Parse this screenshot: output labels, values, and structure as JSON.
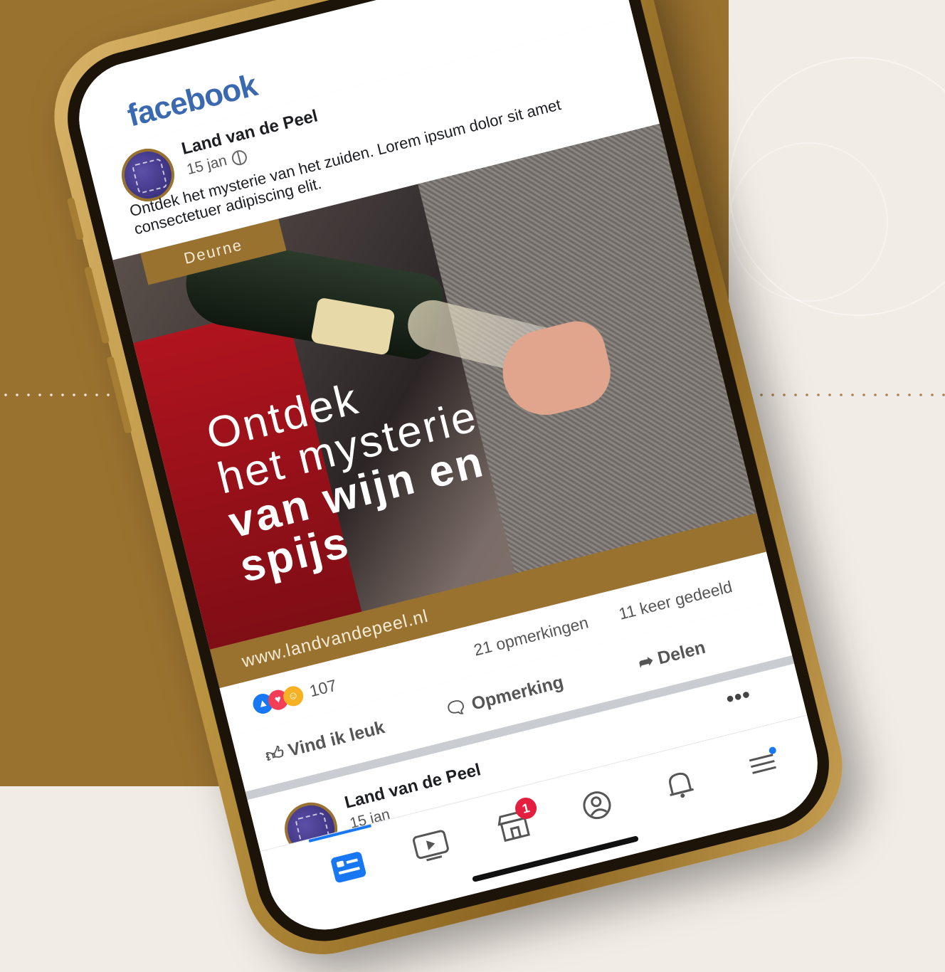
{
  "header": {
    "logo": "facebook",
    "more": "•••"
  },
  "post": {
    "page_name": "Land van de Peel",
    "date": "15 jan",
    "text": "Ontdek het mysterie van het zuiden. Lorem ipsum dolor sit amet consectetuer adipiscing elit.",
    "location_tag": "Deurne",
    "headline_light_1": "Ontdek",
    "headline_light_2": "het mysterie",
    "headline_bold_1": "van wijn en",
    "headline_bold_2": "spijs",
    "url": "www.landvandepeel.nl",
    "reaction_count": "107",
    "comments": "21 opmerkingen",
    "shares": "11 keer gedeeld",
    "like_label": "Vind ik leuk",
    "comment_label": "Opmerking",
    "share_label": "Delen"
  },
  "post2": {
    "page_name": "Land van de Peel",
    "date": "15 jan",
    "more": "•••"
  },
  "nav": {
    "items": [
      "feed-icon",
      "watch-icon",
      "marketplace-icon",
      "profile-icon",
      "bell-icon",
      "menu-icon"
    ],
    "marketplace_badge": "1"
  },
  "colors": {
    "gold": "#9a7230",
    "facebook_blue": "#3a69b0",
    "background": "#f2ece6"
  }
}
